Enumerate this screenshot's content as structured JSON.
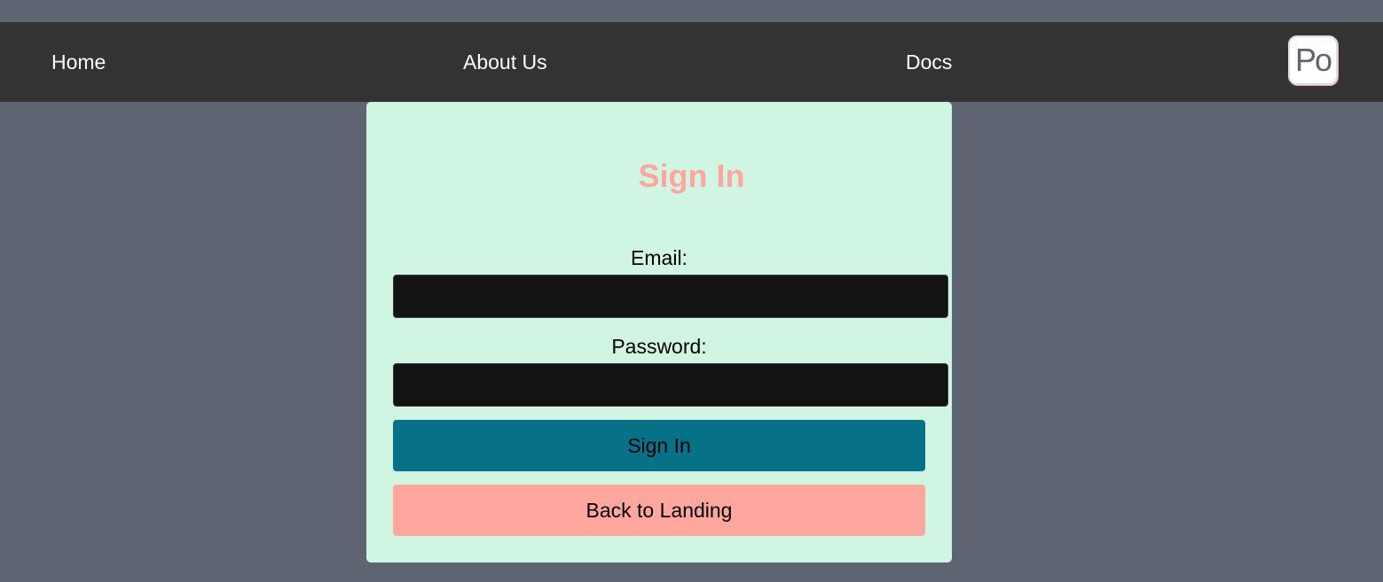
{
  "navbar": {
    "links": [
      {
        "label": "Home"
      },
      {
        "label": "About Us"
      },
      {
        "label": "Docs"
      }
    ],
    "logo_text": "Po"
  },
  "signin_form": {
    "title": "Sign In",
    "email_label": "Email:",
    "email_value": "",
    "password_label": "Password:",
    "password_value": "",
    "submit_label": "Sign In",
    "back_label": "Back to Landing"
  },
  "colors": {
    "page_background": "#5f6473",
    "navbar_background": "#333333",
    "card_background": "#d1f5e3",
    "accent_pink": "#ffa69e",
    "accent_teal": "#077187",
    "input_background": "#131313"
  }
}
